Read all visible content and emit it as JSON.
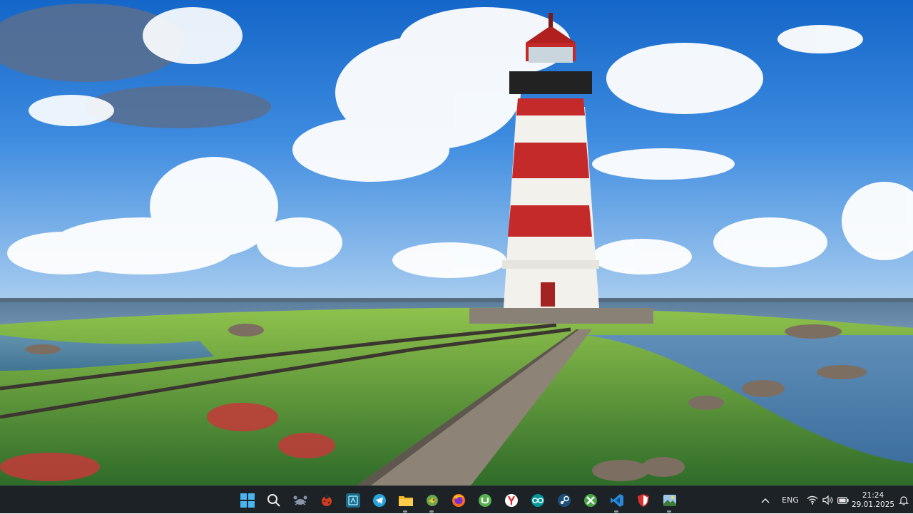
{
  "wallpaper": {
    "description_icon": "lighthouse-landscape"
  },
  "taskbar": {
    "apps": [
      {
        "name": "start-button",
        "icon": "windows-logo"
      },
      {
        "name": "search-button",
        "icon": "search-icon"
      },
      {
        "name": "app-crab-button",
        "icon": "crab-icon"
      },
      {
        "name": "app-ladybug-button",
        "icon": "ladybug-icon"
      },
      {
        "name": "app-capture-button",
        "icon": "capture-icon"
      },
      {
        "name": "telegram-button",
        "icon": "telegram-icon"
      },
      {
        "name": "file-explorer-button",
        "icon": "folder-icon",
        "running": true
      },
      {
        "name": "app-bird-button",
        "icon": "bird-icon",
        "running": true
      },
      {
        "name": "firefox-button",
        "icon": "firefox-icon"
      },
      {
        "name": "utorrent-button",
        "icon": "utorrent-icon"
      },
      {
        "name": "yandex-browser-button",
        "icon": "yandex-icon"
      },
      {
        "name": "arduino-button",
        "icon": "arduino-icon"
      },
      {
        "name": "steam-button",
        "icon": "steam-icon"
      },
      {
        "name": "xbox-button",
        "icon": "xbox-icon"
      },
      {
        "name": "vscode-button",
        "icon": "vscode-icon",
        "running": true
      },
      {
        "name": "shield-app-button",
        "icon": "shield-icon"
      },
      {
        "name": "photos-button",
        "icon": "photos-icon",
        "running": true
      }
    ],
    "tray": {
      "chevron": "chevron-up-icon",
      "language": "ENG",
      "time": "21:24",
      "date": "29.01.2025"
    }
  }
}
